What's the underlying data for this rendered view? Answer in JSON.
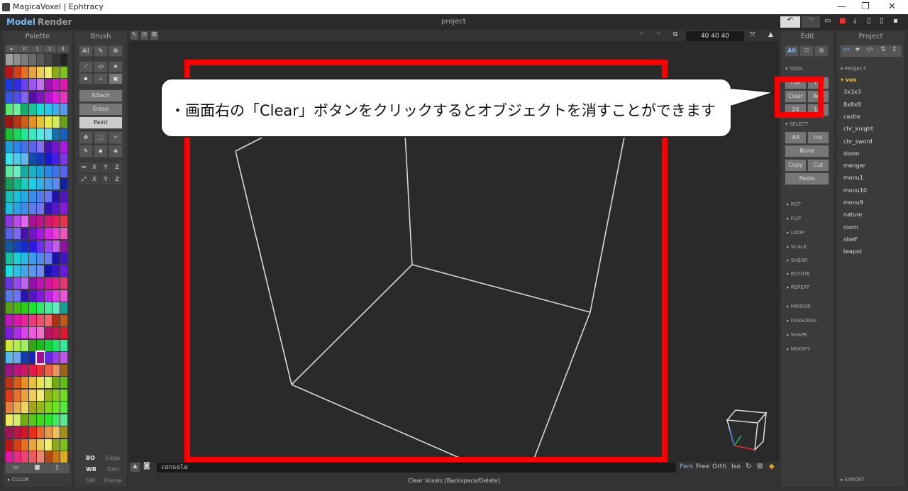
{
  "titlebar": {
    "title": "MagicaVoxel | Ephtracy",
    "min": "—",
    "restore": "❐",
    "close": "✕"
  },
  "menubar": {
    "tab_model": "Model",
    "tab_render": "Render",
    "project_title": "project"
  },
  "palette": {
    "header": "Palette",
    "tabs": [
      "▸",
      "0",
      "1",
      "2",
      "3"
    ],
    "footer_label": "▸ COLOR",
    "selected_color": "#a0108c"
  },
  "brush": {
    "header": "Brush",
    "all": "All",
    "modes": [
      "Attach",
      "Erase",
      "Paint"
    ],
    "axes1": [
      "X",
      "Y",
      "Z"
    ],
    "axes2": [
      "X",
      "Y",
      "Z"
    ],
    "bo": "BO",
    "edge": "Edge",
    "wr": "WR",
    "grid": "Grid",
    "sw": "SW",
    "frame": "Frame"
  },
  "viewport": {
    "dims": "40  40  40",
    "console": "console",
    "cam_modes": [
      "Pers",
      "Free",
      "Orth",
      "Iso"
    ],
    "status": "Clear Voxels [Backspace/Delete]",
    "highlight_color": "#ff0000"
  },
  "edit": {
    "header": "Edit",
    "all": "All",
    "tool_label": "▾ TOOL",
    "tool_buttons": [
      "Full",
      "Fill",
      "Clear",
      "Rev",
      "2X",
      "1/2"
    ],
    "select_label": "▾ SELECT",
    "select_buttons": [
      "All",
      "Inv",
      "None",
      "Copy",
      "Cut",
      "Paste"
    ],
    "sections": [
      "▸ ROT",
      "▸ FLIP",
      "▸ LOOP",
      "▸ SCALE",
      "▸ SHEAR",
      "▸ ROTATE",
      "▸ REPEAT",
      "▸ MIRROR",
      "▸ DIAGONAL",
      "▸ SHAPE",
      "▸ MODIFY"
    ]
  },
  "project": {
    "header": "Project",
    "label": "▾ PROJECT",
    "items": [
      "▾ vox",
      "3x3x3",
      "8x8x8",
      "castle",
      "chr_knight",
      "chr_sword",
      "doom",
      "menger",
      "monu1",
      "monu10",
      "monu9",
      "nature",
      "room",
      "shelf",
      "teapot"
    ],
    "export": "▸ EXPORT"
  },
  "callout": {
    "text": "・画面右の「Clear」ボタンをクリックするとオブジェクトを消すことができます"
  }
}
